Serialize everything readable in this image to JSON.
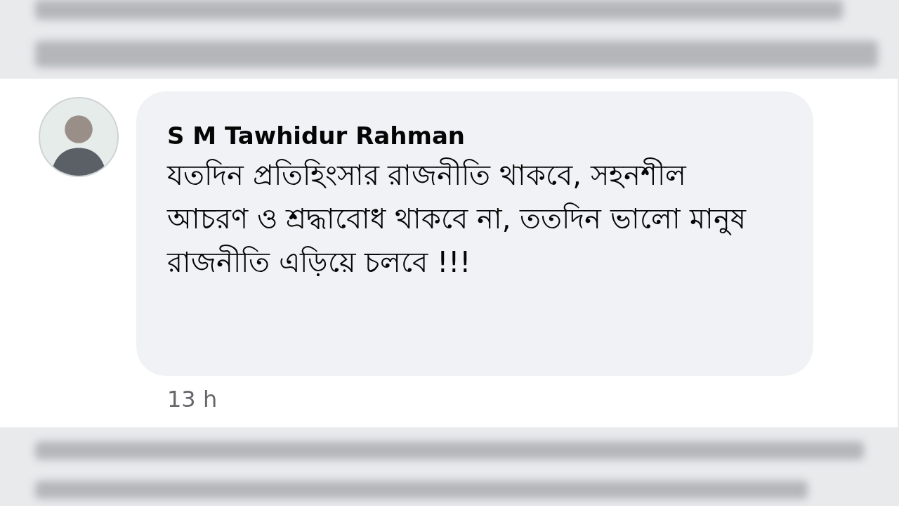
{
  "comment": {
    "author": "S M Tawhidur Rahman",
    "text": "যতদিন প্রতিহিংসার রাজনীতি থাকবে, সহনশীল আচরণ ও শ্রদ্ধাবোধ থাকবে না, ততদিন ভালো মানুষ রাজনীতি এড়িয়ে চলবে !!!",
    "time": "13 h"
  }
}
